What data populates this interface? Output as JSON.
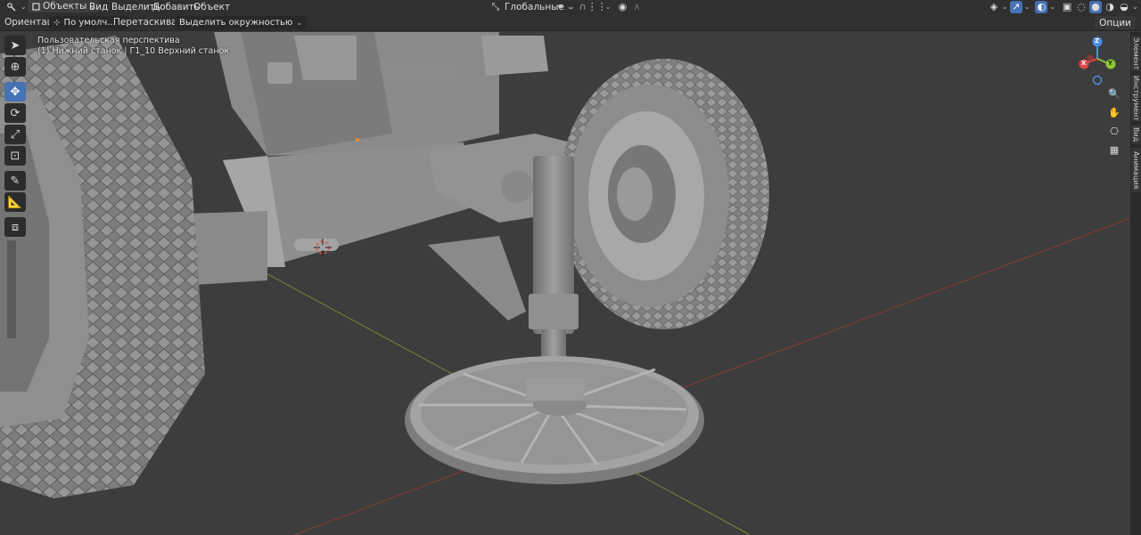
{
  "header": {
    "mode_label": "Объекты",
    "menu": [
      "Вид",
      "Выделить",
      "Добавить",
      "Объект"
    ],
    "transform_orientation": "Глобальные"
  },
  "tool_settings": {
    "orientation_label": "Ориентация:",
    "orientation_value": "По умолч...",
    "drag_label": "Перетаскивание:",
    "drag_value": "Выделить окружностью",
    "options_label": "Опции"
  },
  "viewport": {
    "view_name": "Пользовательская перспектива",
    "collection_info": "(1) Нижний станок | Г1_10 Верхний станок"
  },
  "gizmo": {
    "z_label": "Z",
    "x_label": "X",
    "y_label": "Y"
  },
  "side_tabs": [
    "Элемент",
    "Инструмент",
    "Вид",
    "Анимация"
  ],
  "colors": {
    "accent": "#4772b3",
    "x_axis": "#e04848",
    "y_axis": "#8bc833",
    "z_axis": "#4a8fe8"
  },
  "icons": {
    "editor_type": "view3d-icon",
    "mode": "object-mode-icon",
    "snap": "magnet-icon",
    "proportional": "proportional-edit-icon",
    "overlays": "overlays-icon",
    "xray": "xray-icon",
    "shading": [
      "wireframe-shading-icon",
      "solid-shading-icon",
      "material-shading-icon",
      "rendered-shading-icon"
    ]
  }
}
